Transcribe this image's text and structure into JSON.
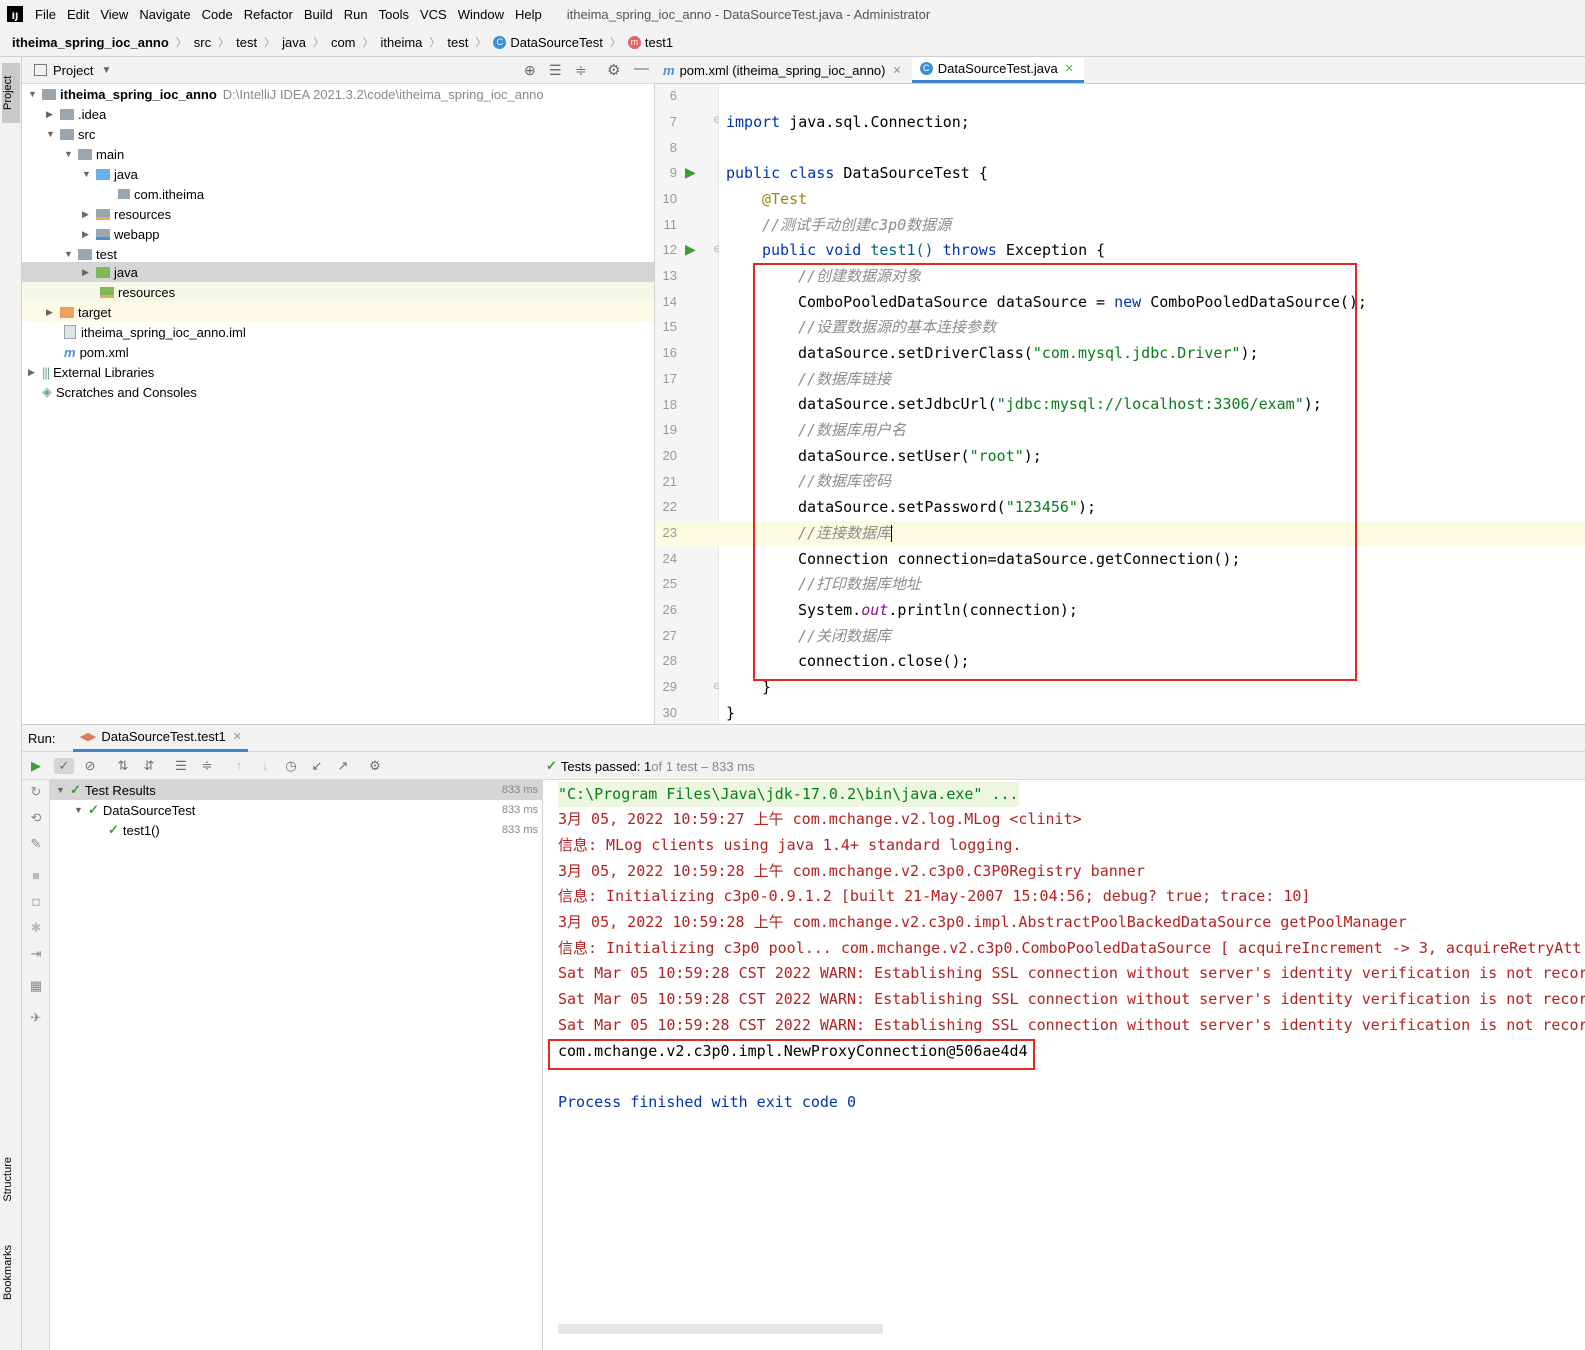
{
  "window": {
    "title": "itheima_spring_ioc_anno - DataSourceTest.java - Administrator"
  },
  "menu": [
    "File",
    "Edit",
    "View",
    "Navigate",
    "Code",
    "Refactor",
    "Build",
    "Run",
    "Tools",
    "VCS",
    "Window",
    "Help"
  ],
  "breadcrumb": [
    "itheima_spring_ioc_anno",
    "src",
    "test",
    "java",
    "com",
    "itheima",
    "test",
    "DataSourceTest",
    "test1"
  ],
  "project_panel": {
    "title": "Project",
    "root_name": "itheima_spring_ioc_anno",
    "root_path": "D:\\IntelliJ IDEA 2021.3.2\\code\\itheima_spring_ioc_anno",
    "nodes": [
      ".idea",
      "src",
      "main",
      "java",
      "com.itheima",
      "resources",
      "webapp",
      "test",
      "java",
      "resources",
      "target",
      "itheima_spring_ioc_anno.iml",
      "pom.xml",
      "External Libraries",
      "Scratches and Consoles"
    ]
  },
  "editor_tabs": [
    "pom.xml (itheima_spring_ioc_anno)",
    "DataSourceTest.java"
  ],
  "line_numbers": [
    "6",
    "7",
    "8",
    "9",
    "10",
    "11",
    "12",
    "13",
    "14",
    "15",
    "16",
    "17",
    "18",
    "19",
    "20",
    "21",
    "22",
    "23",
    "24",
    "25",
    "26",
    "27",
    "28",
    "29",
    "30"
  ],
  "code": {
    "l7_kw": "import",
    "l7_rest": " java.sql.Connection;",
    "l9_kw": "public class",
    "l9_rest": " DataSourceTest {",
    "l10": "@Test",
    "l11": "//测试手动创建c3p0数据源",
    "l12_kw1": "public void",
    "l12_mid": " test1() ",
    "l12_kw2": "throws",
    "l12_rest": " Exception {",
    "l13": "//创建数据源对象",
    "l14_a": "ComboPooledDataSource dataSource = ",
    "l14_kw": "new",
    "l14_b": " ComboPooledDataSource();",
    "l15": "//设置数据源的基本连接参数",
    "l16_a": "dataSource.setDriverClass(",
    "l16_s": "\"com.mysql.jdbc.Driver\"",
    "l16_b": ");",
    "l17": "//数据库链接",
    "l18_a": "dataSource.setJdbcUrl(",
    "l18_s": "\"jdbc:mysql://localhost:3306/exam\"",
    "l18_b": ");",
    "l19": "//数据库用户名",
    "l20_a": "dataSource.setUser(",
    "l20_s": "\"root\"",
    "l20_b": ");",
    "l21": "//数据库密码",
    "l22_a": "dataSource.setPassword(",
    "l22_s": "\"123456\"",
    "l22_b": ");",
    "l23": "//连接数据库",
    "l24": "Connection connection=dataSource.getConnection();",
    "l25": "//打印数据库地址",
    "l26_a": "System.",
    "l26_f": "out",
    "l26_b": ".println(connection);",
    "l27": "//关闭数据库",
    "l28": "connection.close();",
    "l29": "}",
    "l30": "}"
  },
  "run": {
    "label": "Run:",
    "tab": "DataSourceTest.test1",
    "status_bold": "Tests passed: 1",
    "status_rest": " of 1 test – 833 ms",
    "tree": [
      {
        "name": "Test Results",
        "time": "833 ms"
      },
      {
        "name": "DataSourceTest",
        "time": "833 ms"
      },
      {
        "name": "test1()",
        "time": "833 ms"
      }
    ]
  },
  "console": [
    "\"C:\\Program Files\\Java\\jdk-17.0.2\\bin\\java.exe\" ...",
    "3月 05, 2022 10:59:27 上午 com.mchange.v2.log.MLog <clinit>",
    "信息: MLog clients using java 1.4+ standard logging.",
    "3月 05, 2022 10:59:28 上午 com.mchange.v2.c3p0.C3P0Registry banner",
    "信息: Initializing c3p0-0.9.1.2 [built 21-May-2007 15:04:56; debug? true; trace: 10]",
    "3月 05, 2022 10:59:28 上午 com.mchange.v2.c3p0.impl.AbstractPoolBackedDataSource getPoolManager",
    "信息: Initializing c3p0 pool... com.mchange.v2.c3p0.ComboPooledDataSource [ acquireIncrement -> 3, acquireRetryAtt",
    "Sat Mar 05 10:59:28 CST 2022 WARN: Establishing SSL connection without server's identity verification is not recor",
    "Sat Mar 05 10:59:28 CST 2022 WARN: Establishing SSL connection without server's identity verification is not recor",
    "Sat Mar 05 10:59:28 CST 2022 WARN: Establishing SSL connection without server's identity verification is not recor",
    "com.mchange.v2.c3p0.impl.NewProxyConnection@506ae4d4",
    "Process finished with exit code 0"
  ],
  "side_tabs": {
    "project": "Project",
    "structure": "Structure",
    "bookmarks": "Bookmarks"
  },
  "colors": {
    "keyword": "#0033b3",
    "string": "#067d17",
    "comment": "#8c8c8c",
    "annotation": "#9e880d",
    "console_red": "#b22222",
    "highlight_box": "#e8281e"
  }
}
